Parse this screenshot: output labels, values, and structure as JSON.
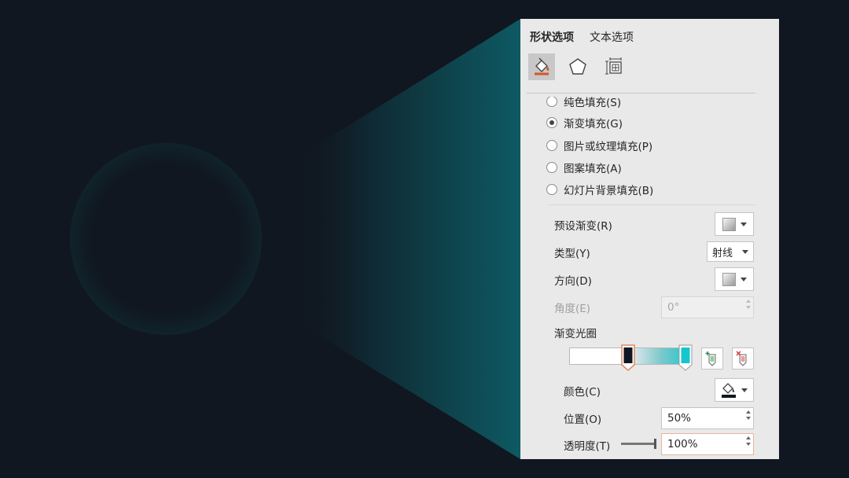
{
  "panel": {
    "tabs": [
      {
        "label": "形状选项",
        "active": true
      },
      {
        "label": "文本选项",
        "active": false
      }
    ],
    "subtabs": [
      "fill-line-icon",
      "effects-icon",
      "size-properties-icon"
    ],
    "fill_options": [
      {
        "label": "纯色填充(S)",
        "checked": false
      },
      {
        "label": "渐变填充(G)",
        "checked": true
      },
      {
        "label": "图片或纹理填充(P)",
        "checked": false
      },
      {
        "label": "图案填充(A)",
        "checked": false
      },
      {
        "label": "幻灯片背景填充(B)",
        "checked": false
      }
    ],
    "preset_label": "预设渐变(R)",
    "type_label": "类型(Y)",
    "type_value": "射线",
    "direction_label": "方向(D)",
    "angle_label": "角度(E)",
    "angle_value": "0°",
    "stops_label": "渐变光圈",
    "color_label": "颜色(C)",
    "position_label": "位置(O)",
    "position_value": "50%",
    "transparency_label": "透明度(T)",
    "transparency_value": "100%",
    "transparency_slider": 1.0,
    "gradient_stops": [
      {
        "position": 0.5,
        "color": "#101720"
      },
      {
        "position": 1.0,
        "color": "#17c6cc"
      }
    ]
  },
  "colors": {
    "background": "#101720",
    "accent": "#17c6cc",
    "panel_bg": "#e9e9e9",
    "selected_stop_border": "#e08a5a"
  }
}
